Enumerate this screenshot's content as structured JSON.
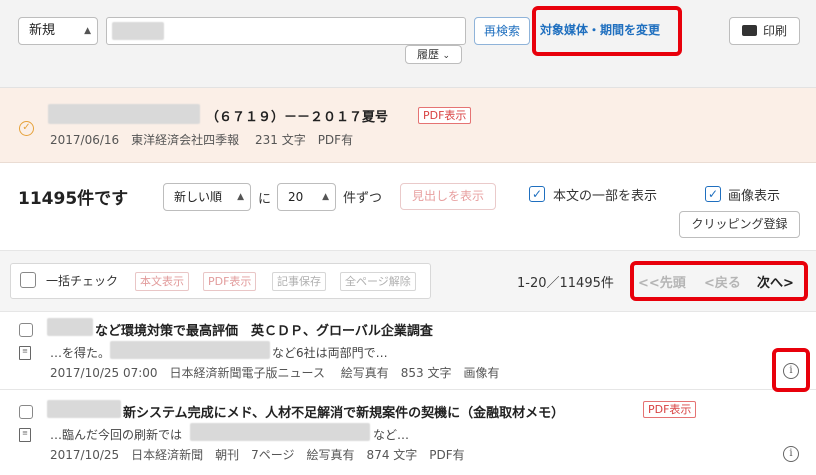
{
  "search": {
    "mode_select": "新規",
    "query_value": "",
    "research_button": "再検索",
    "change_scope_link": "対象媒体・期間を変更",
    "history_button": "履歴",
    "print_button": "印刷"
  },
  "current_article": {
    "title": "（６７１９）－－２０１７夏号",
    "pdf_badge": "PDF表示",
    "meta": "2017/06/16　東洋経済会社四季報　 231 文字　PDF有"
  },
  "results": {
    "count_text": "11495件です",
    "sort_select": "新しい順",
    "sort_connector": "に",
    "per_page_select": "20",
    "per_page_suffix": "件ずつ",
    "show_headlines_button": "見出しを表示",
    "show_partial_body_label": "本文の一部を表示",
    "show_images_label": "画像表示",
    "clipping_button": "クリッピング登録"
  },
  "bulk": {
    "check_all_label": "一括チェック",
    "body_button": "本文表示",
    "pdf_button": "PDF表示",
    "save_button": "記事保存",
    "clear_button": "全ページ解除"
  },
  "pagination": {
    "range": "1-20／11495件",
    "first": "<<先頭",
    "prev": "<戻る",
    "next": "次へ>"
  },
  "articles": [
    {
      "title": "など環境対策で最高評価　英ＣＤＰ、グローバル企業調査",
      "snippet_pre": "…を得た。",
      "snippet_post": "など6社は両部門で…",
      "meta": "2017/10/25 07:00　日本経済新聞電子版ニュース　 絵写真有　853 文字　画像有"
    },
    {
      "title": "新システム完成にメド、人材不足解消で新規案件の契機に（金融取材メモ）",
      "pdf_badge": "PDF表示",
      "snippet_pre": "…臨んだ今回の刷新では",
      "snippet_post": "など…",
      "meta": "2017/10/25　日本経済新聞　朝刊　7ページ　絵写真有　874 文字　PDF有"
    }
  ],
  "colors": {
    "highlight": "#e8000b",
    "link_blue": "#1f6fbf",
    "article_panel_bg": "#fbefe7"
  }
}
